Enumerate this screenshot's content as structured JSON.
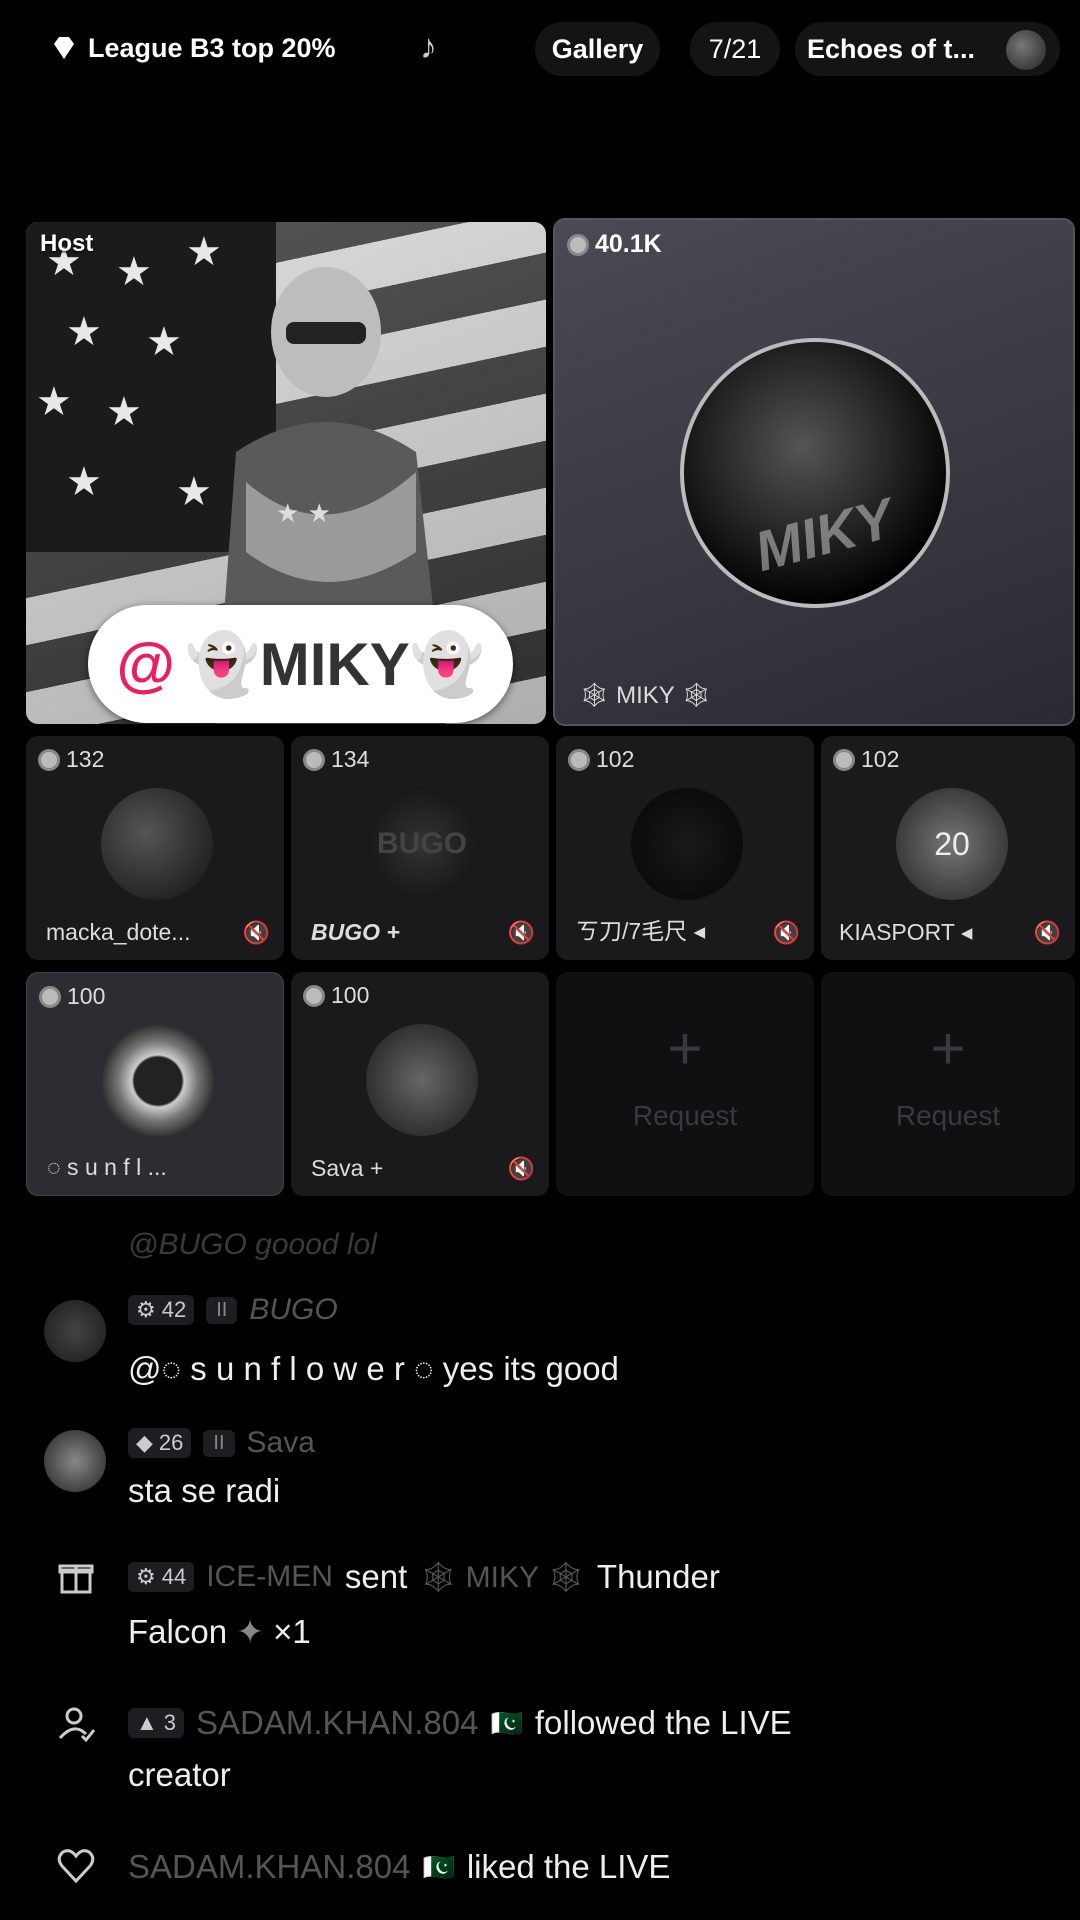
{
  "topbar": {
    "league": "League B3 top 20%",
    "gallery": "Gallery",
    "count": "7/21",
    "song": "Echoes of t..."
  },
  "host": {
    "label": "Host",
    "mention_at": "@",
    "mention_name": "👻MIKY👻"
  },
  "main_guest": {
    "coins": "40.1K",
    "avatar_text": "MIKY",
    "name": "🕸 MIKY 🕸"
  },
  "guests": [
    {
      "coins": "132",
      "name": "macka_dote..."
    },
    {
      "coins": "134",
      "name": "BUGO +",
      "avatar_text": "BUGO"
    },
    {
      "coins": "102",
      "name": "ㄎ刀/7毛尺 ◂"
    },
    {
      "coins": "102",
      "name": "KIASPORT ◂",
      "avatar_text": "20"
    },
    {
      "coins": "100",
      "name": "◌ s u n f l ..."
    },
    {
      "coins": "100",
      "name": "Sava +"
    }
  ],
  "request": {
    "label": "Request"
  },
  "chat": {
    "faded": "@BUGO goood lol",
    "m1": {
      "level": "42",
      "badge": "II",
      "user": "BUGO",
      "text": "@◌ s u n f l o w e r ◌ yes its good"
    },
    "m2": {
      "level": "26",
      "badge": "II",
      "user": "Sava",
      "text": "sta se radi"
    },
    "m3": {
      "level": "44",
      "user": "ICE-MEN",
      "sent": "sent",
      "recipient": "🕸 MIKY 🕸",
      "gift": "Thunder",
      "gift2": "Falcon",
      "qty": "×1"
    },
    "m4": {
      "level": "3",
      "user": "SADAM.KHAN.804",
      "flag": "🇵🇰",
      "text": "followed the LIVE",
      "text2": "creator"
    },
    "m5": {
      "user": "SADAM.KHAN.804",
      "flag": "🇵🇰",
      "text": "liked the LIVE"
    }
  }
}
